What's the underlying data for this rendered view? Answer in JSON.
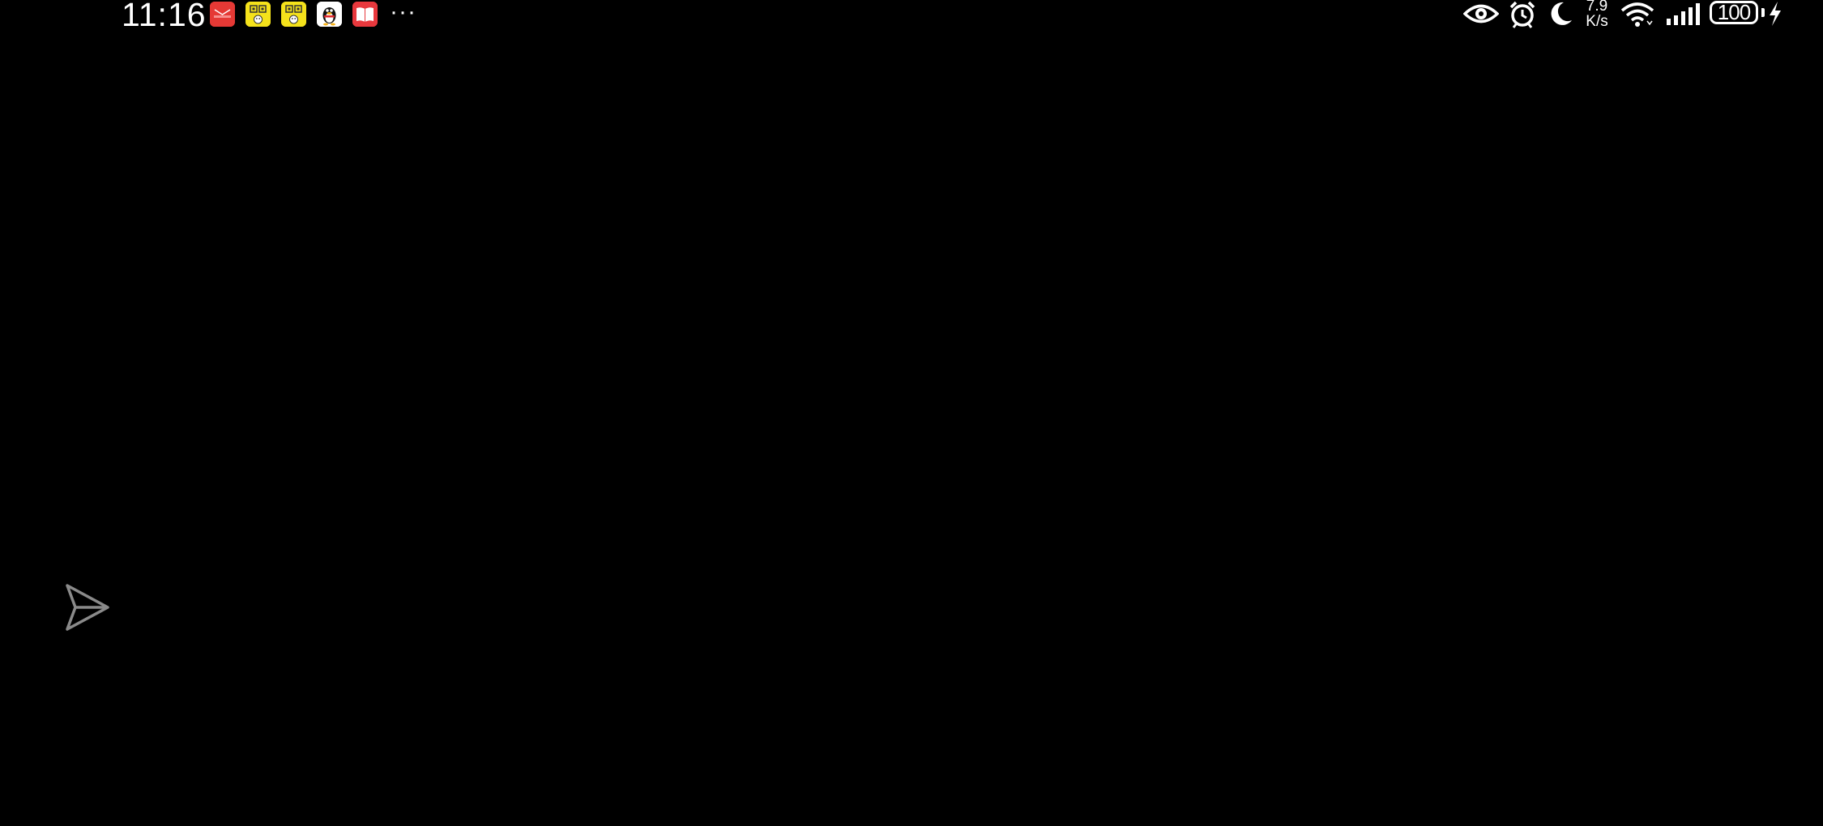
{
  "status_bar": {
    "time": "11:16",
    "notification_icons": [
      "mail-app-icon",
      "qr-app-icon",
      "qr-app-icon",
      "qq-penguin-icon",
      "book-app-icon"
    ],
    "overflow": "···",
    "network_speed_value": "7.9",
    "network_speed_unit": "K/s",
    "battery_level": "100",
    "system_icons": [
      "eye-comfort-icon",
      "alarm-icon",
      "do-not-disturb-moon-icon",
      "wifi-icon",
      "cellular-signal-icon",
      "charging-bolt-icon"
    ]
  },
  "floating_button": {
    "icon": "send-icon"
  },
  "colors": {
    "background": "#000000",
    "status_text": "#ffffff",
    "mail_red": "#e53935",
    "qr_yellow": "#f5e21b",
    "book_red": "#e8383d",
    "send_icon_gray": "#8a8a8a"
  }
}
